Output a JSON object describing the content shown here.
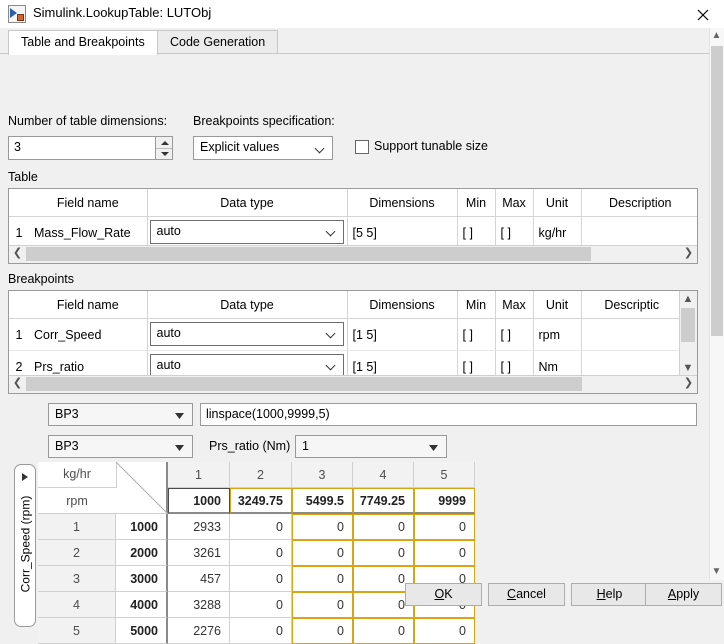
{
  "window": {
    "title": "Simulink.LookupTable: LUTObj",
    "icon": "simulink-icon",
    "close_label": "✕"
  },
  "tabs": [
    {
      "label": "Table and Breakpoints",
      "selected": true
    },
    {
      "label": "Code Generation",
      "selected": false
    }
  ],
  "settings": {
    "dimensions_label": "Number of table dimensions:",
    "dimensions_value": "3",
    "bp_spec_label": "Breakpoints specification:",
    "bp_spec_value": "Explicit values",
    "tunable_label": "Support tunable size",
    "tunable_checked": false
  },
  "table_section": {
    "title": "Table",
    "columns": [
      "Field name",
      "Data type",
      "Dimensions",
      "Min",
      "Max",
      "Unit",
      "Description"
    ],
    "rows": [
      {
        "index": "1",
        "field_name": "Mass_Flow_Rate",
        "data_type": "auto",
        "dimensions": "[5 5]",
        "min": "[ ]",
        "max": "[ ]",
        "unit": "kg/hr",
        "description": ""
      }
    ]
  },
  "breakpoints_section": {
    "title": "Breakpoints",
    "columns": [
      "Field name",
      "Data type",
      "Dimensions",
      "Min",
      "Max",
      "Unit",
      "Descriptic"
    ],
    "rows": [
      {
        "index": "1",
        "field_name": "Corr_Speed",
        "data_type": "auto",
        "dimensions": "[1 5]",
        "min": "[ ]",
        "max": "[ ]",
        "unit": "rpm",
        "description": ""
      },
      {
        "index": "2",
        "field_name": "Prs_ratio",
        "data_type": "auto",
        "dimensions": "[1 5]",
        "min": "[ ]",
        "max": "[ ]",
        "unit": "Nm",
        "description": ""
      }
    ]
  },
  "editor": {
    "bp_select_1": "BP3",
    "expression": "linspace(1000,9999,5)",
    "bp_select_2": "BP3",
    "slice_label": "Prs_ratio (Nm)",
    "slice_value": "1"
  },
  "data_grid": {
    "col_unit": "kg/hr",
    "row_unit": "rpm",
    "side_tab_label": "Corr_Speed (rpm)",
    "column_indices": [
      "1",
      "2",
      "3",
      "4",
      "5"
    ],
    "column_breakpoints": [
      "1000",
      "3249.75",
      "5499.5",
      "7749.25",
      "9999"
    ],
    "row_indices": [
      "1",
      "2",
      "3",
      "4",
      "5"
    ],
    "row_breakpoints": [
      "1000",
      "2000",
      "3000",
      "4000",
      "5000"
    ],
    "values": [
      [
        "2933",
        "0",
        "0",
        "0",
        "0"
      ],
      [
        "3261",
        "0",
        "0",
        "0",
        "0"
      ],
      [
        "457",
        "0",
        "0",
        "0",
        "0"
      ],
      [
        "3288",
        "0",
        "0",
        "0",
        "0"
      ],
      [
        "2276",
        "0",
        "0",
        "0",
        "0"
      ]
    ],
    "highlight_color": "#d9a515",
    "selected_cell_color": "#4d4d4d",
    "highlighted_columns": [
      2,
      3,
      4
    ],
    "selected_breakpoint_column": 0
  },
  "buttons": [
    {
      "pre": "",
      "mn": "O",
      "post": "K"
    },
    {
      "pre": "",
      "mn": "C",
      "post": "ancel"
    },
    {
      "pre": "",
      "mn": "H",
      "post": "elp"
    },
    {
      "pre": "",
      "mn": "A",
      "post": "pply"
    }
  ]
}
